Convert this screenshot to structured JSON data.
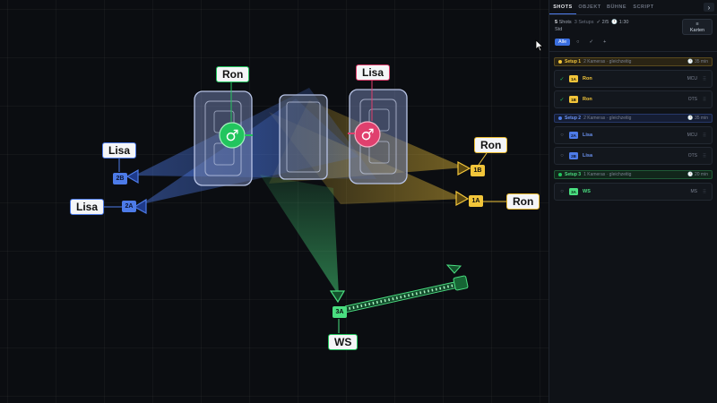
{
  "canvas": {
    "actors": [
      {
        "id": "ron",
        "label": "Ron",
        "symbol": "♂",
        "color": "#22c55e"
      },
      {
        "id": "lisa",
        "label": "Lisa",
        "symbol": "♂",
        "color": "#e0406e"
      }
    ],
    "cameras": [
      {
        "id": "2B",
        "target": "Lisa",
        "color": "#4d7be8"
      },
      {
        "id": "2A",
        "target": "Lisa",
        "color": "#4d7be8"
      },
      {
        "id": "1B",
        "target": "Ron",
        "color": "#f2c53a"
      },
      {
        "id": "1A",
        "target": "Ron",
        "color": "#f2c53a"
      },
      {
        "id": "3A",
        "target": "WS",
        "color": "#4ade80"
      }
    ]
  },
  "panel": {
    "tabs": [
      "SHOTS",
      "OBJEKT",
      "BÜHNE",
      "SCRIPT"
    ],
    "tab_next_icon": "chevron-right-icon",
    "summary": {
      "count": "5",
      "count_label": "Shots",
      "setups": "3 Setups",
      "done": "✓ 2/5",
      "time": "1:30",
      "sub": "Std"
    },
    "cards_button": {
      "icon": "≡",
      "label": "Karten"
    },
    "filters": [
      "Alle",
      "○",
      "✓",
      "+"
    ],
    "setups": [
      {
        "name": "Setup 1",
        "meta": "2 Kameras · gleichzeitig",
        "duration": "35 min",
        "shots": [
          {
            "status": "✓",
            "id": "1A",
            "character": "Ron",
            "type": "MCU"
          },
          {
            "status": "✓",
            "id": "1B",
            "character": "Ron",
            "type": "OTS"
          }
        ]
      },
      {
        "name": "Setup 2",
        "meta": "2 Kameras · gleichzeitig",
        "duration": "35 min",
        "shots": [
          {
            "status": "○",
            "id": "2A",
            "character": "Lisa",
            "type": "MCU"
          },
          {
            "status": "○",
            "id": "2B",
            "character": "Lisa",
            "type": "OTS"
          }
        ]
      },
      {
        "name": "Setup 3",
        "meta": "1 Kameras · gleichzeitig",
        "duration": "20 min",
        "shots": [
          {
            "status": "○",
            "id": "3A",
            "character": "WS",
            "type": "MS"
          }
        ]
      }
    ],
    "grip_icon": "⠿"
  },
  "colors": {
    "blue": "#4d7be8",
    "yellow": "#f2c53a",
    "green": "#22c55e",
    "pink": "#e0406e",
    "background": "#0b0d11"
  }
}
